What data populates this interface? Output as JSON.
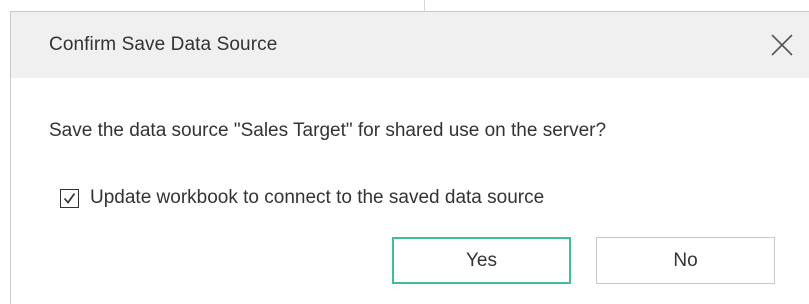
{
  "dialog": {
    "title": "Confirm Save Data Source",
    "message": "Save the data source \"Sales Target\" for shared use on the server?",
    "checkbox": {
      "label": "Update workbook to connect to the saved data source",
      "checked": true
    },
    "buttons": {
      "yes": "Yes",
      "no": "No"
    },
    "colors": {
      "primary_border": "#3fbf97",
      "title_bg": "#f0f0f0",
      "text": "#333333"
    },
    "icons": {
      "close": "close-icon",
      "check": "checkmark-icon"
    }
  }
}
